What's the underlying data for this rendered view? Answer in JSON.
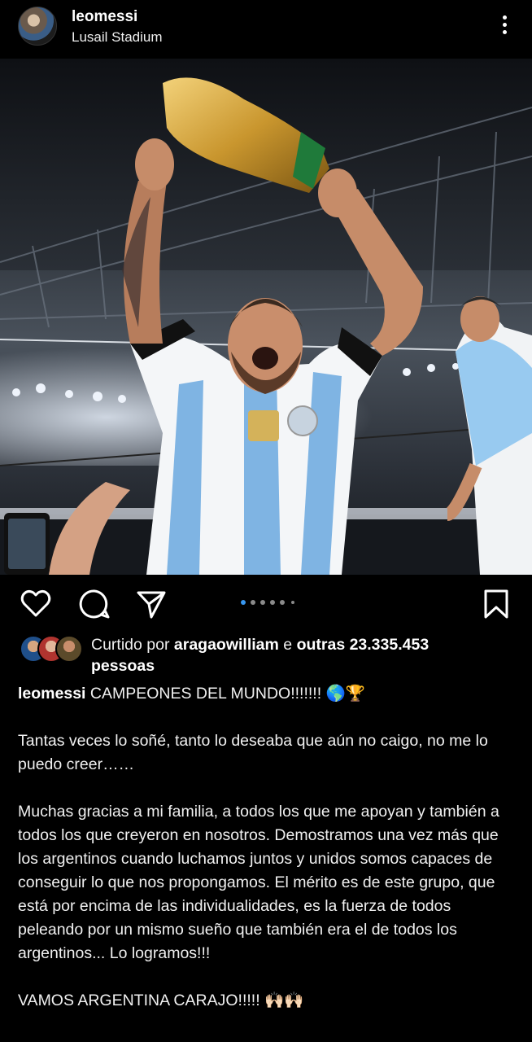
{
  "header": {
    "username": "leomessi",
    "location": "Lusail Stadium",
    "avatar_icon": "profile-avatar",
    "more_icon": "more-vertical-icon"
  },
  "photo": {
    "alt_subject": "Player lifting trophy in stadium"
  },
  "actions": {
    "like_icon": "heart-icon",
    "comment_icon": "comment-icon",
    "share_icon": "send-icon",
    "save_icon": "bookmark-icon",
    "carousel_dots": 6,
    "carousel_active": 1
  },
  "likes": {
    "prefix": "Curtido por",
    "user": "aragaowilliam",
    "connector": "e",
    "others": "outras 23.335.453",
    "suffix": "pessoas"
  },
  "caption": {
    "username": "leomessi",
    "line1": "CAMPEONES DEL MUNDO!!!!!!! 🌎🏆",
    "para2": "Tantas veces lo soñé, tanto lo deseaba que aún no caigo, no me lo puedo creer……",
    "para3": "Muchas gracias a mi familia, a todos los que me apoyan y también a todos los que creyeron en nosotros. Demostramos una vez más que los argentinos cuando luchamos juntos y unidos somos capaces de conseguir lo que nos propongamos. El mérito es de este grupo, que está por encima de las individualidades, es la fuerza de todos peleando por un mismo sueño que también era el de todos los argentinos... Lo logramos!!!",
    "para4": "VAMOS ARGENTINA CARAJO!!!!! 🙌🏻🙌🏻"
  },
  "colors": {
    "background": "#000000",
    "text": "#f5f5f5",
    "dot_active": "#3897f0",
    "dot_inactive": "#8a8a8a"
  }
}
